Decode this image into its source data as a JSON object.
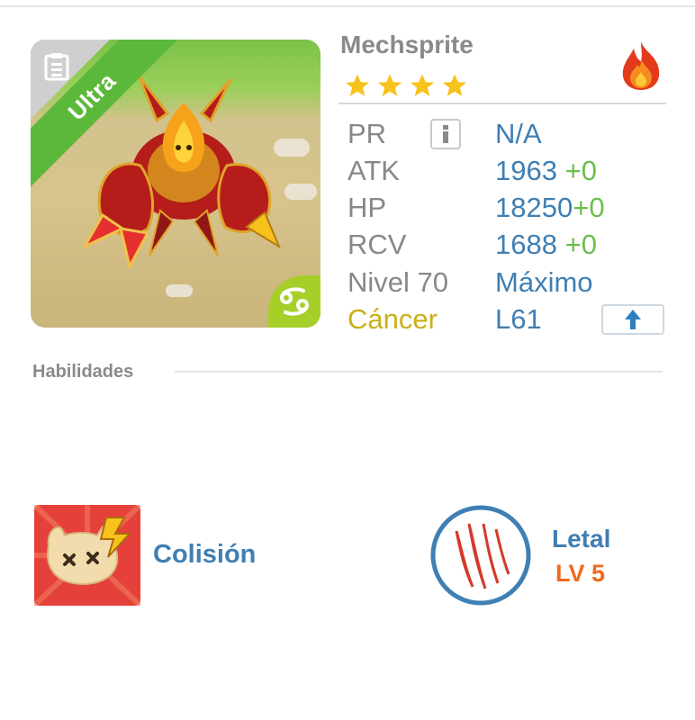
{
  "monster": {
    "name": "Mechsprite",
    "rarity_label": "Ultra",
    "stars": 4,
    "element_icon": "fire-element-icon",
    "sign_icon": "cancer-zodiac-icon"
  },
  "stats": {
    "pr": {
      "label": "PR",
      "value": "N/A"
    },
    "atk": {
      "label": "ATK",
      "value": "1963",
      "bonus": "+0"
    },
    "hp": {
      "label": "HP",
      "value": "18250",
      "bonus": "+0"
    },
    "rcv": {
      "label": "RCV",
      "value": "1688",
      "bonus": "+0"
    },
    "level": {
      "label": "Nivel 70",
      "value": "Máximo"
    },
    "sign": {
      "label": "Cáncer",
      "value": "L61"
    }
  },
  "skills_section": {
    "title": "Habilidades",
    "skill": {
      "name": "Colisión",
      "icon": "collision-skill-icon"
    },
    "ability": {
      "name": "Letal",
      "level": "LV 5",
      "icon": "claw-ability-icon"
    }
  },
  "colors": {
    "accent_blue": "#3f7fb3",
    "bonus_green": "#6abf4b",
    "sign_yellow": "#c9b016",
    "level_orange": "#ee6a1c",
    "ultra_green": "#5cb83a"
  }
}
